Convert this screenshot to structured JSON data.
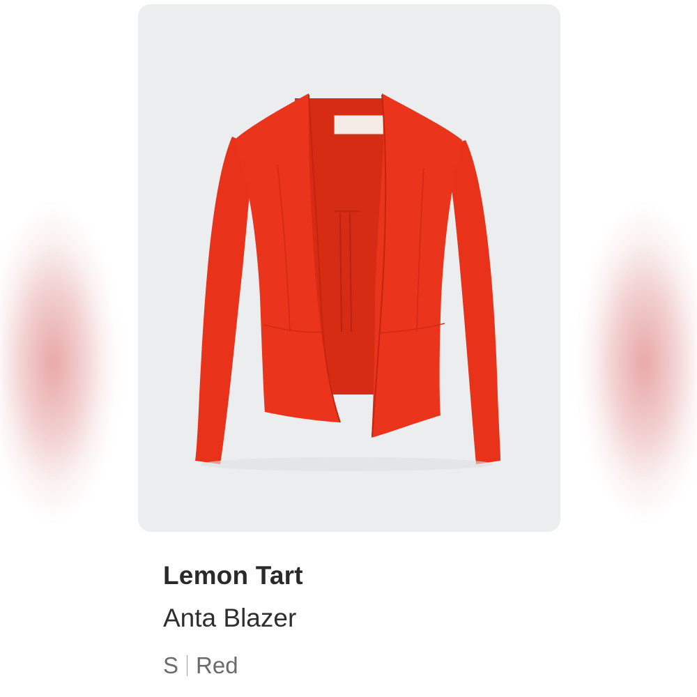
{
  "product": {
    "brand": "Lemon Tart",
    "name": "Anta Blazer",
    "size": "S",
    "color": "Red",
    "image_icon": "red-blazer-image"
  },
  "colors": {
    "garment": "#e8321a",
    "panel_background": "#ecedef"
  }
}
